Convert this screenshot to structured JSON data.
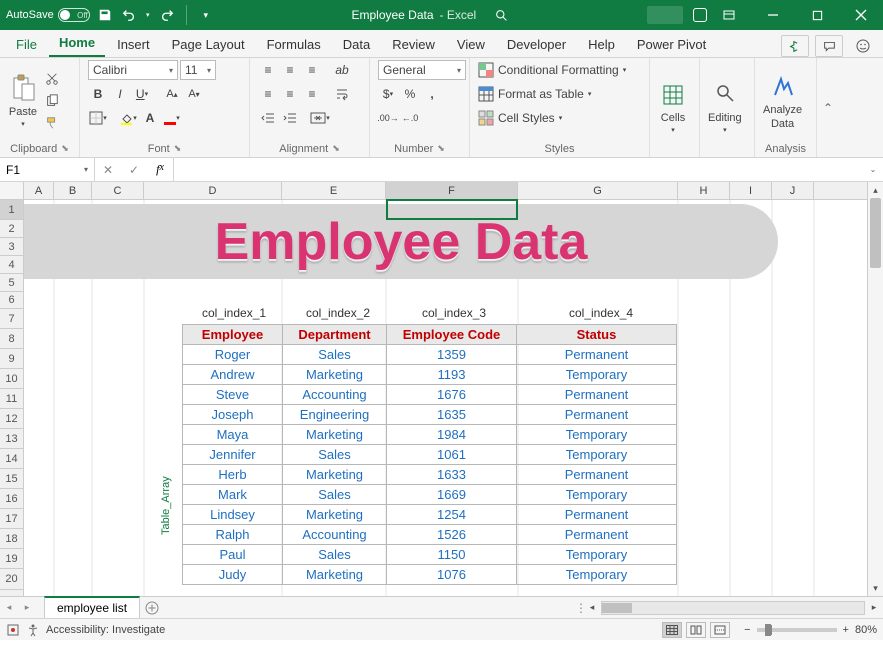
{
  "titlebar": {
    "autosave_label": "AutoSave",
    "autosave_state": "Off",
    "title_doc": "Employee Data",
    "title_app": "-  Excel"
  },
  "ribbon_tabs": [
    "File",
    "Home",
    "Insert",
    "Page Layout",
    "Formulas",
    "Data",
    "Review",
    "View",
    "Developer",
    "Help",
    "Power Pivot"
  ],
  "ribbon_active_tab": "Home",
  "clipboard": {
    "paste": "Paste",
    "group_label": "Clipboard"
  },
  "font": {
    "name": "Calibri",
    "size": "11",
    "group_label": "Font"
  },
  "alignment": {
    "group_label": "Alignment"
  },
  "number": {
    "format": "General",
    "group_label": "Number"
  },
  "styles": {
    "conditional": "Conditional Formatting",
    "table": "Format as Table",
    "cell": "Cell Styles",
    "group_label": "Styles"
  },
  "cells": {
    "label": "Cells"
  },
  "editing": {
    "label": "Editing"
  },
  "analysis": {
    "btn": "Analyze",
    "btn2": "Data",
    "group_label": "Analysis"
  },
  "formulabar": {
    "namebox": "F1",
    "formula": ""
  },
  "sheet": {
    "banner": "Employee Data",
    "col_labels": [
      "col_index_1",
      "col_index_2",
      "col_index_3",
      "col_index_4"
    ],
    "table_array_label": "Table_Array",
    "headers": [
      "Employee",
      "Department",
      "Employee Code",
      "Status"
    ],
    "rows": [
      [
        "Roger",
        "Sales",
        "1359",
        "Permanent"
      ],
      [
        "Andrew",
        "Marketing",
        "1193",
        "Temporary"
      ],
      [
        "Steve",
        "Accounting",
        "1676",
        "Permanent"
      ],
      [
        "Joseph",
        "Engineering",
        "1635",
        "Permanent"
      ],
      [
        "Maya",
        "Marketing",
        "1984",
        "Temporary"
      ],
      [
        "Jennifer",
        "Sales",
        "1061",
        "Temporary"
      ],
      [
        "Herb",
        "Marketing",
        "1633",
        "Permanent"
      ],
      [
        "Mark",
        "Sales",
        "1669",
        "Temporary"
      ],
      [
        "Lindsey",
        "Marketing",
        "1254",
        "Permanent"
      ],
      [
        "Ralph",
        "Accounting",
        "1526",
        "Permanent"
      ],
      [
        "Paul",
        "Sales",
        "1150",
        "Temporary"
      ],
      [
        "Judy",
        "Marketing",
        "1076",
        "Temporary"
      ]
    ],
    "columns": [
      "A",
      "B",
      "C",
      "D",
      "E",
      "F",
      "G",
      "H",
      "I",
      "J"
    ],
    "row_numbers": [
      "1",
      "2",
      "3",
      "4",
      "5",
      "6",
      "7",
      "8",
      "9",
      "10",
      "11",
      "12",
      "13",
      "14",
      "15",
      "16",
      "17",
      "18",
      "19",
      "20"
    ],
    "active_tab": "employee list"
  },
  "statusbar": {
    "accessibility": "Accessibility: Investigate",
    "zoom": "80%"
  },
  "chart_data": {
    "type": "table",
    "title": "Employee Data",
    "columns": [
      "Employee",
      "Department",
      "Employee Code",
      "Status"
    ],
    "rows": [
      [
        "Roger",
        "Sales",
        1359,
        "Permanent"
      ],
      [
        "Andrew",
        "Marketing",
        1193,
        "Temporary"
      ],
      [
        "Steve",
        "Accounting",
        1676,
        "Permanent"
      ],
      [
        "Joseph",
        "Engineering",
        1635,
        "Permanent"
      ],
      [
        "Maya",
        "Marketing",
        1984,
        "Temporary"
      ],
      [
        "Jennifer",
        "Sales",
        1061,
        "Temporary"
      ],
      [
        "Herb",
        "Marketing",
        1633,
        "Permanent"
      ],
      [
        "Mark",
        "Sales",
        1669,
        "Temporary"
      ],
      [
        "Lindsey",
        "Marketing",
        1254,
        "Permanent"
      ],
      [
        "Ralph",
        "Accounting",
        1526,
        "Permanent"
      ],
      [
        "Paul",
        "Sales",
        1150,
        "Temporary"
      ],
      [
        "Judy",
        "Marketing",
        1076,
        "Temporary"
      ]
    ]
  }
}
